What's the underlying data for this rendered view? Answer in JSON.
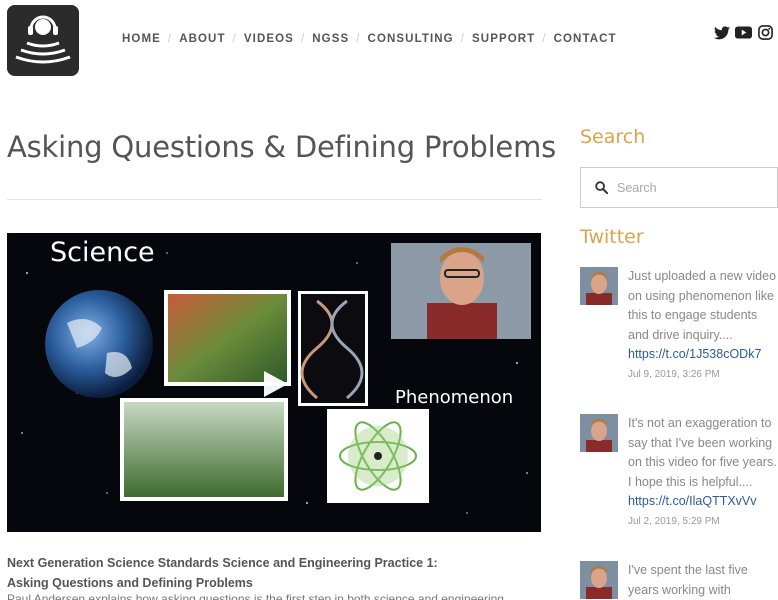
{
  "header": {
    "nav": [
      {
        "label": "HOME"
      },
      {
        "label": "ABOUT"
      },
      {
        "label": "VIDEOS"
      },
      {
        "label": "NGSS"
      },
      {
        "label": "CONSULTING"
      },
      {
        "label": "SUPPORT"
      },
      {
        "label": "CONTACT"
      }
    ],
    "social": [
      "twitter-icon",
      "youtube-icon",
      "instagram-icon"
    ]
  },
  "main": {
    "title": "Asking Questions & Defining Problems",
    "video": {
      "overlay_title": "Science",
      "overlay_label": "Phenomenon"
    },
    "description_title_line1": "Next Generation Science Standards Science and Engineering Practice 1:",
    "description_title_line2": "Asking Questions and Defining Problems",
    "description_body": "Paul Andersen explains how asking questions is the first step in both science and engineering."
  },
  "sidebar": {
    "search_heading": "Search",
    "search_placeholder": "Search",
    "twitter_heading": "Twitter",
    "tweets": [
      {
        "text": "Just uploaded a new video on using phenomenon like this to engage students and drive inquiry....",
        "link": "https://t.co/1J538cODk7",
        "date": "Jul 9, 2019, 3:26 PM"
      },
      {
        "text": "It's not an exaggeration to say that I've been working on this video for five years. I hope this is helpful....",
        "link": "https://t.co/IlaQTTXvVv",
        "date": "Jul 2, 2019, 5:29 PM"
      },
      {
        "text": "I've spent the last five years working with",
        "link": "",
        "date": ""
      }
    ]
  },
  "colors": {
    "accent": "#d9a54a",
    "link": "#2d5a9a",
    "text": "#555555"
  }
}
